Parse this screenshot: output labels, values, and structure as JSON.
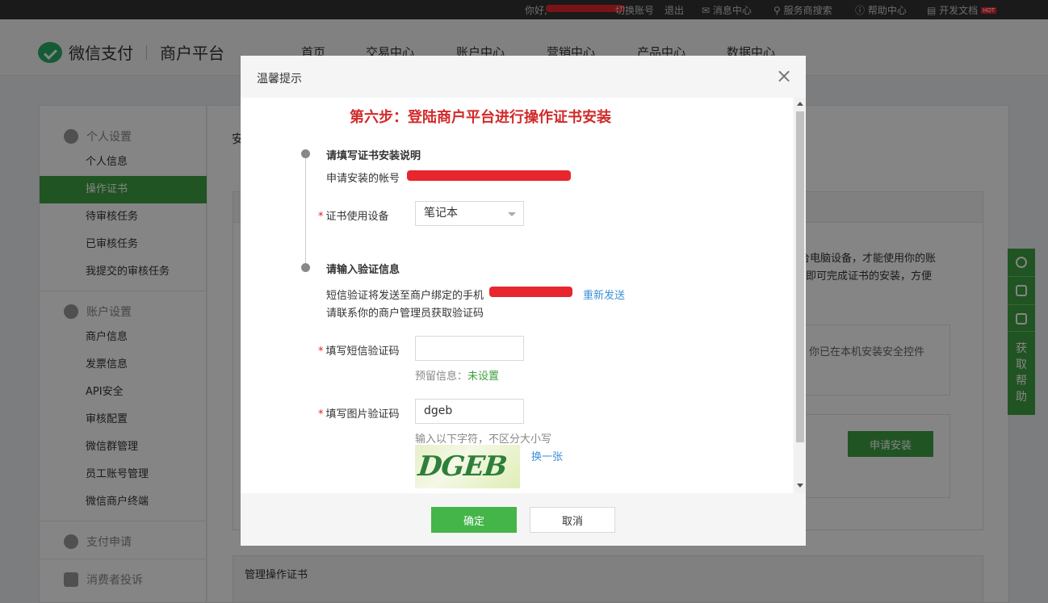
{
  "topbar": {
    "greeting_prefix": "你好,",
    "switch_account": "切换账号",
    "logout": "退出",
    "messages": "消息中心",
    "provider_search": "服务商搜索",
    "help_center": "帮助中心",
    "dev_docs": "开发文档",
    "hot_badge": "HOT"
  },
  "header": {
    "logo_text": "微信支付",
    "platform_text": "商户平台",
    "nav": [
      "首页",
      "交易中心",
      "账户中心",
      "营销中心",
      "产品中心",
      "数据中心"
    ]
  },
  "sidebar": {
    "group_personal": "个人设置",
    "personal_items": [
      "个人信息",
      "操作证书",
      "待审核任务",
      "已审核任务",
      "我提交的审核任务"
    ],
    "group_account": "账户设置",
    "account_items": [
      "商户信息",
      "发票信息",
      "API安全",
      "审核配置",
      "微信群管理",
      "员工账号管理",
      "微信商户终端"
    ],
    "group_pay_apply": "支付申请",
    "group_complaint": "消费者投诉"
  },
  "main": {
    "title_fragment": "安",
    "desc_line1": "台电脑设备，才能使用你的账",
    "desc_line2": "即可完成证书的安装，方便",
    "control_hint": "你已在本机安装安全控件",
    "apply_button": "申请安装",
    "manage_title": "管理操作证书"
  },
  "float": {
    "help_label": "获取帮助"
  },
  "dialog": {
    "title": "温馨提示",
    "step_title": "第六步：登陆商户平台进行操作证书安装",
    "section1_title": "请填写证书安装说明",
    "account_label": "申请安装的帐号",
    "device_label": "证书使用设备",
    "device_value": "笔记本",
    "section2_title": "请输入验证信息",
    "sms_notice": "短信验证将发送至商户绑定的手机",
    "resend": "重新发送",
    "contact_admin": "请联系你的商户管理员获取验证码",
    "sms_label": "填写短信验证码",
    "sms_value": "",
    "reserved_label": "预留信息：",
    "reserved_value": "未设置",
    "captcha_label": "填写图片验证码",
    "captcha_value": "dgeb",
    "captcha_hint": "输入以下字符，不区分大小写",
    "captcha_image_text": "DGEB",
    "refresh_captcha": "换一张",
    "required_mark": "*",
    "ok_button": "确定",
    "cancel_button": "取消"
  }
}
